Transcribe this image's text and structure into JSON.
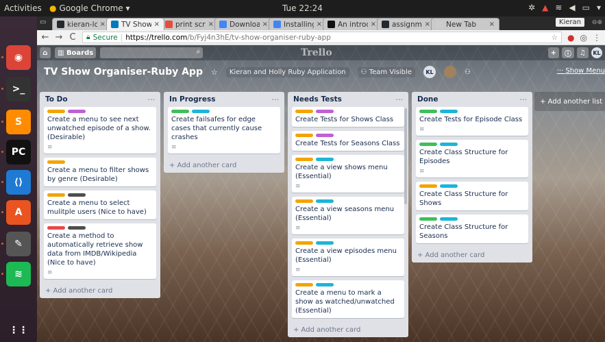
{
  "system": {
    "activities": "Activities",
    "app_name": "Google Chrome ▾",
    "clock": "Tue 22:24",
    "user": "Kieran"
  },
  "launcher": [
    {
      "name": "chrome-icon",
      "glyph": "◉",
      "color": "#db4437"
    },
    {
      "name": "terminal-icon",
      "glyph": ">_",
      "color": "#333333"
    },
    {
      "name": "sublime-icon",
      "glyph": "S",
      "color": "#ff8c00"
    },
    {
      "name": "pycharm-icon",
      "glyph": "PC",
      "color": "#111111"
    },
    {
      "name": "vscode-icon",
      "glyph": "⟨⟩",
      "color": "#1f7ad4"
    },
    {
      "name": "software-center-icon",
      "glyph": "A",
      "color": "#e95420"
    },
    {
      "name": "text-editor-icon",
      "glyph": "✎",
      "color": "#555555"
    },
    {
      "name": "spotify-icon",
      "glyph": "≋",
      "color": "#1db954"
    },
    {
      "name": "app-grid-icon",
      "glyph": "⋮⋮",
      "color": "transparent"
    }
  ],
  "browser": {
    "tabs": [
      {
        "title": "kieran-locky",
        "fav": "#24292e"
      },
      {
        "title": "TV Show Or",
        "fav": "#0079bf",
        "active": true
      },
      {
        "title": "print screen",
        "fav": "#e74c3c"
      },
      {
        "title": "Download",
        "fav": "#4285f4"
      },
      {
        "title": "Installing P",
        "fav": "#4285f4"
      },
      {
        "title": "An introdu",
        "fav": "#111111"
      },
      {
        "title": "assignment",
        "fav": "#24292e"
      },
      {
        "title": "New Tab",
        "fav": "#cccccc"
      }
    ],
    "secure": "Secure",
    "url_host": "https://trello.com",
    "url_path": "/b/Fyj4n3hE/tv-show-organiser-ruby-app"
  },
  "trello": {
    "boards_label": "Boards",
    "logo": "Trello",
    "user_initials": "KL",
    "board_title": "TV Show Organiser-Ruby App",
    "team": "Kieran and Holly Ruby Application",
    "visibility": "Team Visible",
    "show_menu": "Show Menu",
    "add_list": "+ Add another list",
    "add_card": "+ Add another card",
    "colors": {
      "orange": "#f2a400",
      "purple": "#c05fd4",
      "green": "#3fbf58",
      "blue": "#1cb5d8",
      "red": "#e8484a",
      "black": "#4d4d4d"
    },
    "lists": [
      {
        "title": "To Do",
        "cards": [
          {
            "labels": [
              "orange",
              "purple"
            ],
            "title": "Create a menu to see next unwatched episode of a show. (Desirable)",
            "desc": true
          },
          {
            "labels": [
              "orange"
            ],
            "title": "Create a menu to filter shows by genre (Desirable)",
            "desc": false
          },
          {
            "labels": [
              "orange",
              "black"
            ],
            "title": "Create a menu to select mulitple users (Nice to have)",
            "desc": false
          },
          {
            "labels": [
              "red",
              "black"
            ],
            "title": "Create a method to automatically retrieve show data from IMDB/Wikipedia (Nice to have)",
            "desc": true
          }
        ]
      },
      {
        "title": "In Progress",
        "cards": [
          {
            "labels": [
              "green",
              "blue"
            ],
            "title": "Create failsafes for edge cases that currently cause crashes",
            "desc": true
          }
        ]
      },
      {
        "title": "Needs Tests",
        "cards": [
          {
            "labels": [
              "orange",
              "purple"
            ],
            "title": "Create Tests for Shows Class",
            "desc": false
          },
          {
            "labels": [
              "orange",
              "purple"
            ],
            "title": "Create Tests for Seasons Class",
            "desc": false
          },
          {
            "labels": [
              "orange",
              "blue"
            ],
            "title": "Create a view shows menu (Essential)",
            "desc": true
          },
          {
            "labels": [
              "orange",
              "blue"
            ],
            "title": "Create a view seasons menu (Essential)",
            "desc": true
          },
          {
            "labels": [
              "orange",
              "blue"
            ],
            "title": "Create a view episodes menu (Essential)",
            "desc": true
          },
          {
            "labels": [
              "orange",
              "blue"
            ],
            "title": "Create a menu to mark a show as watched/unwatched (Essential)",
            "desc": false
          }
        ]
      },
      {
        "title": "Done",
        "cards": [
          {
            "labels": [
              "green",
              "blue"
            ],
            "title": "Create Tests for Episode Class",
            "desc": true
          },
          {
            "labels": [
              "green",
              "blue"
            ],
            "title": "Create Class Structure for Episodes",
            "desc": true
          },
          {
            "labels": [
              "orange",
              "blue"
            ],
            "title": "Create Class Structure for Shows",
            "desc": false
          },
          {
            "labels": [
              "green",
              "blue"
            ],
            "title": "Create Class Structure for Seasons",
            "desc": false
          }
        ]
      }
    ]
  }
}
